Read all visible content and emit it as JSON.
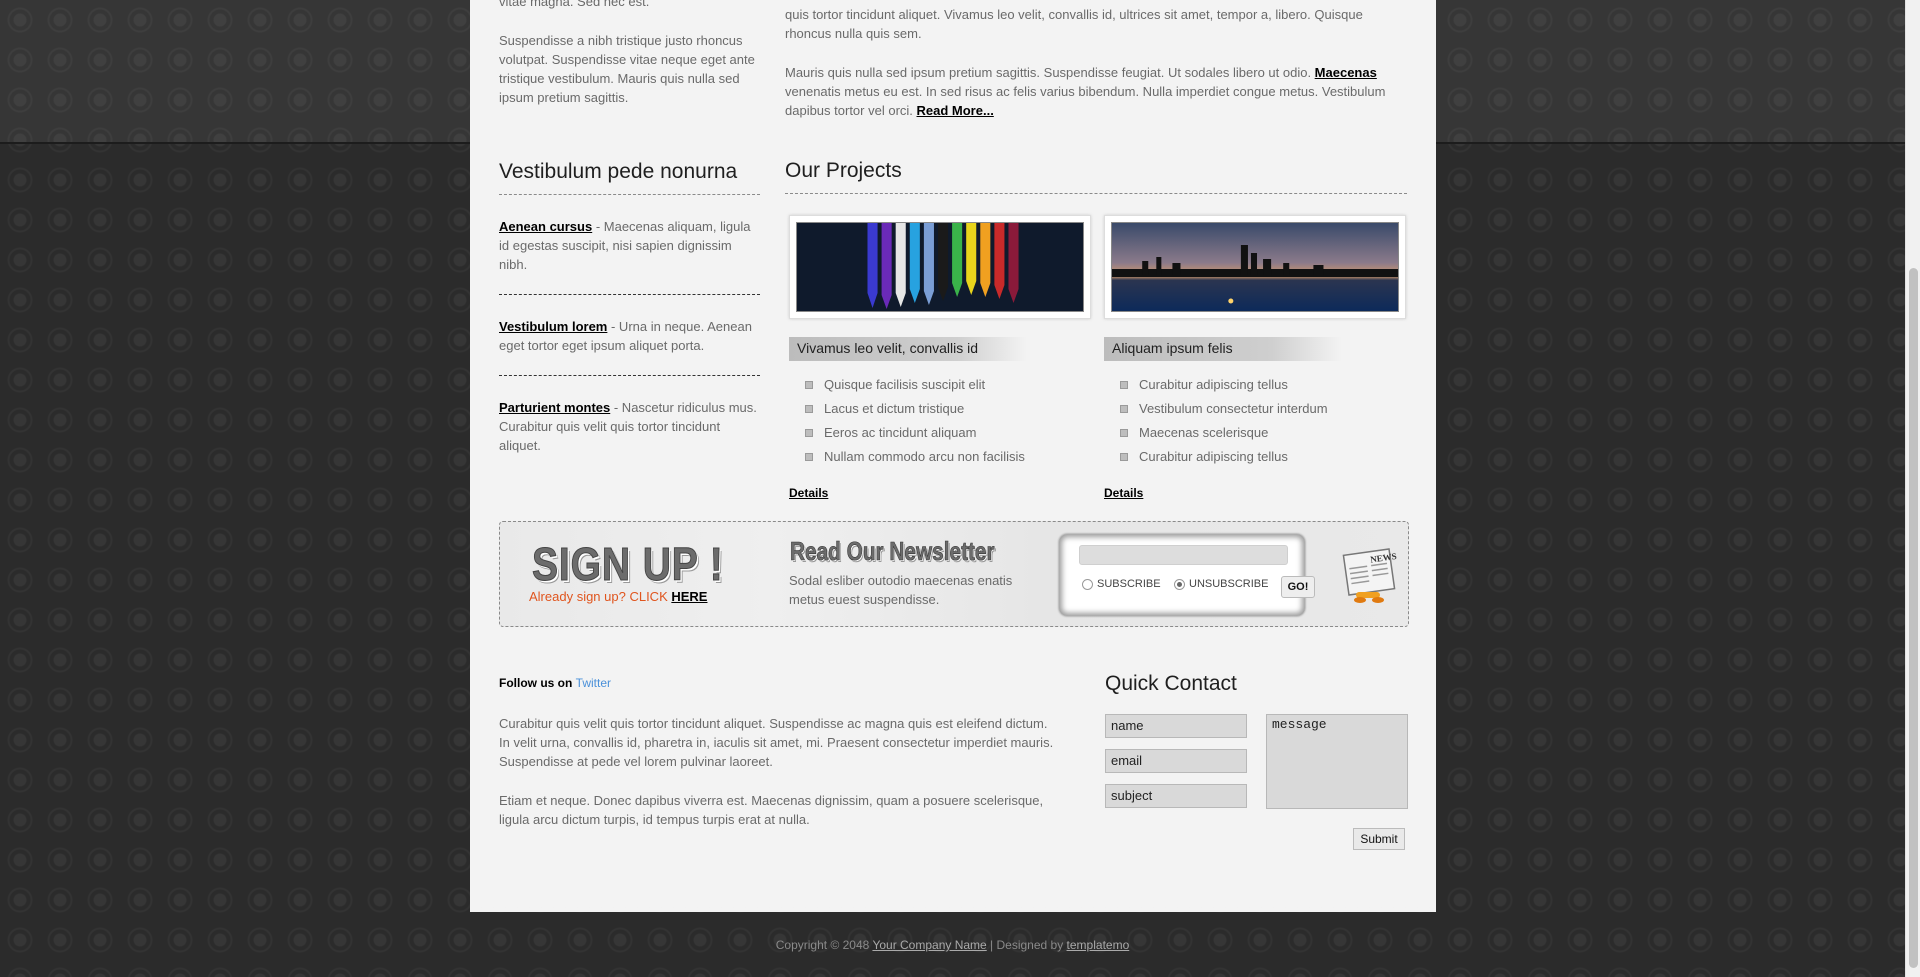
{
  "top": {
    "left_partial_1": "vitae magna. Sed nec est.",
    "left_para": "Suspendisse a nibh tristique justo rhoncus volutpat. Suspendisse vitae neque eget ante tristique vestibulum. Mauris quis nulla sed ipsum pretium sagittis.",
    "right_partial_1": "quis tortor tincidunt aliquet. Vivamus leo velit, convallis id, ultrices sit amet, tempor a, libero. Quisque rhoncus nulla quis sem.",
    "right_para_start": "Mauris quis nulla sed ipsum pretium sagittis. Suspendisse feugiat. Ut sodales libero ut odio. ",
    "right_para_link": "Maecenas",
    "right_para_end": " venenatis metus eu est. In sed risus ac felis varius bibendum. Nulla imperdiet congue metus. Vestibulum dapibus tortor vel orci. ",
    "read_more": "Read More..."
  },
  "news": {
    "title": "Vestibulum pede nonurna",
    "items": [
      {
        "link": "Aenean cursus",
        "text": " - Maecenas aliquam, ligula id egestas suscipit, nisi sapien dignissim nibh."
      },
      {
        "link": "Vestibulum lorem",
        "text": " - Urna in neque. Aenean eget tortor eget ipsum aliquet porta."
      },
      {
        "link": "Parturient montes",
        "text": " - Nascetur ridiculus mus. Curabitur quis velit quis tortor tincidunt aliquet."
      }
    ]
  },
  "projects": {
    "title": "Our Projects",
    "items": [
      {
        "title": "Vivamus leo velit, convallis id",
        "bullets": [
          "Quisque facilisis suscipit elit",
          "Lacus et dictum tristique",
          "Eeros ac tincidunt aliquam",
          "Nullam commodo arcu non facilisis"
        ],
        "details": "Details"
      },
      {
        "title": "Aliquam ipsum felis",
        "bullets": [
          "Curabitur adipiscing tellus",
          "Vestibulum consectetur interdum",
          "Maecenas scelerisque",
          "Curabitur adipiscing tellus"
        ],
        "details": "Details"
      }
    ]
  },
  "signup": {
    "title": "SIGN UP !",
    "sub_text": "Already sign up? CLICK ",
    "sub_link": "HERE",
    "newsletter_title": "Read Our Newsletter",
    "newsletter_text": "Sodal esliber outodio maecenas enatis metus euest suspendisse.",
    "subscribe_label": "SUBSCRIBE",
    "unsubscribe_label": "UNSUBSCRIBE",
    "go_label": "GO!",
    "news_badge": "NEWS"
  },
  "footer": {
    "follow_prefix": "Follow us on ",
    "follow_link": "Twitter",
    "para1": "Curabitur quis velit quis tortor tincidunt aliquet. Suspendisse ac magna quis est eleifend dictum. In velit urna, convallis id, pharetra in, iaculis sit amet, mi. Praesent consectetur imperdiet mauris. Suspendisse at pede vel lorem pulvinar laoreet.",
    "para2": "Etiam et neque. Donec dapibus viverra est. Maecenas dignissim, quam a posuere scelerisque, ligula arcu dictum turpis, id tempus turpis erat at nulla."
  },
  "contact": {
    "title": "Quick Contact",
    "name_value": "name",
    "email_value": "email",
    "subject_value": "subject",
    "message_value": "message",
    "submit_label": "Submit"
  },
  "copyright": {
    "prefix": "Copyright © 2048 ",
    "company": "Your Company Name",
    "middle": " | Designed by ",
    "designer": "templatemo"
  }
}
